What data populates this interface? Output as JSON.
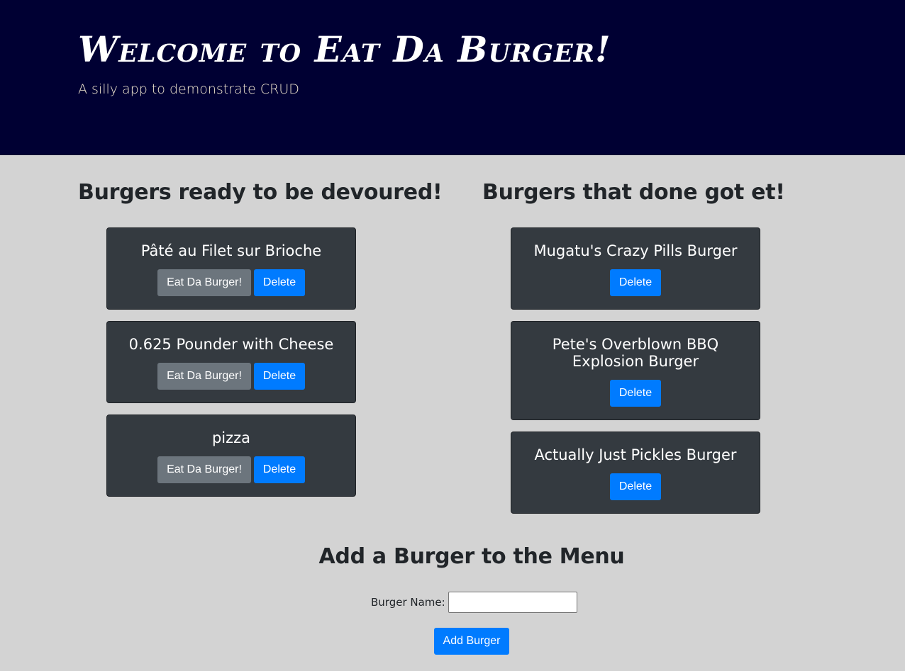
{
  "header": {
    "title": "Welcome to Eat Da Burger!",
    "subtitle": "A silly app to demonstrate CRUD"
  },
  "ready": {
    "heading": "Burgers ready to be devoured!",
    "burgers": [
      {
        "name": "Pâté au Filet sur Brioche",
        "eat_label": "Eat Da Burger!",
        "delete_label": "Delete"
      },
      {
        "name": "0.625 Pounder with Cheese",
        "eat_label": "Eat Da Burger!",
        "delete_label": "Delete"
      },
      {
        "name": "pizza",
        "eat_label": "Eat Da Burger!",
        "delete_label": "Delete"
      }
    ]
  },
  "devoured": {
    "heading": "Burgers that done got et!",
    "burgers": [
      {
        "name": "Mugatu's Crazy Pills Burger",
        "delete_label": "Delete"
      },
      {
        "name": "Pete's Overblown BBQ Explosion Burger",
        "delete_label": "Delete"
      },
      {
        "name": "Actually Just Pickles Burger",
        "delete_label": "Delete"
      }
    ]
  },
  "add_form": {
    "heading": "Add a Burger to the Menu",
    "label": "Burger Name:",
    "value": "",
    "submit_label": "Add Burger"
  },
  "colors": {
    "header_bg": "#000033",
    "page_bg": "#d3d3d3",
    "card_bg": "#343a40",
    "primary": "#007bff",
    "secondary": "#6c757d"
  }
}
